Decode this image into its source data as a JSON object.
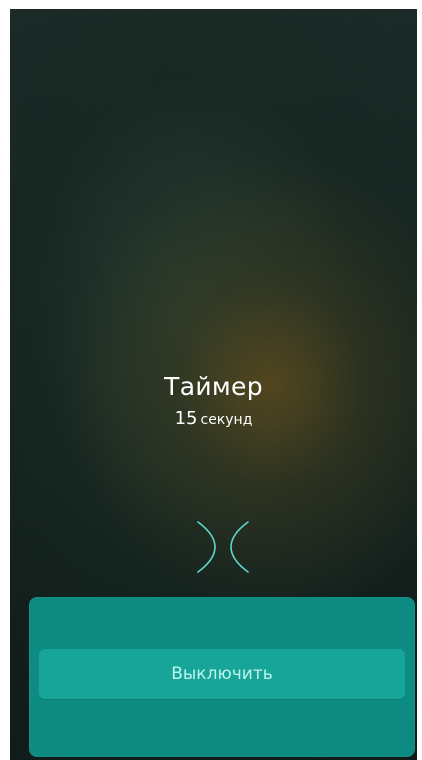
{
  "timer": {
    "title": "Таймер",
    "value": "15",
    "unit": "секунд"
  },
  "actions": {
    "turn_off_label": "Выключить"
  },
  "icons": {
    "collapse": "chevron-collapse-icon"
  },
  "colors": {
    "panel": "#0a8a80",
    "button": "#17a499",
    "button_text": "#bff3ee",
    "icon_stroke": "#5fd6ca"
  }
}
